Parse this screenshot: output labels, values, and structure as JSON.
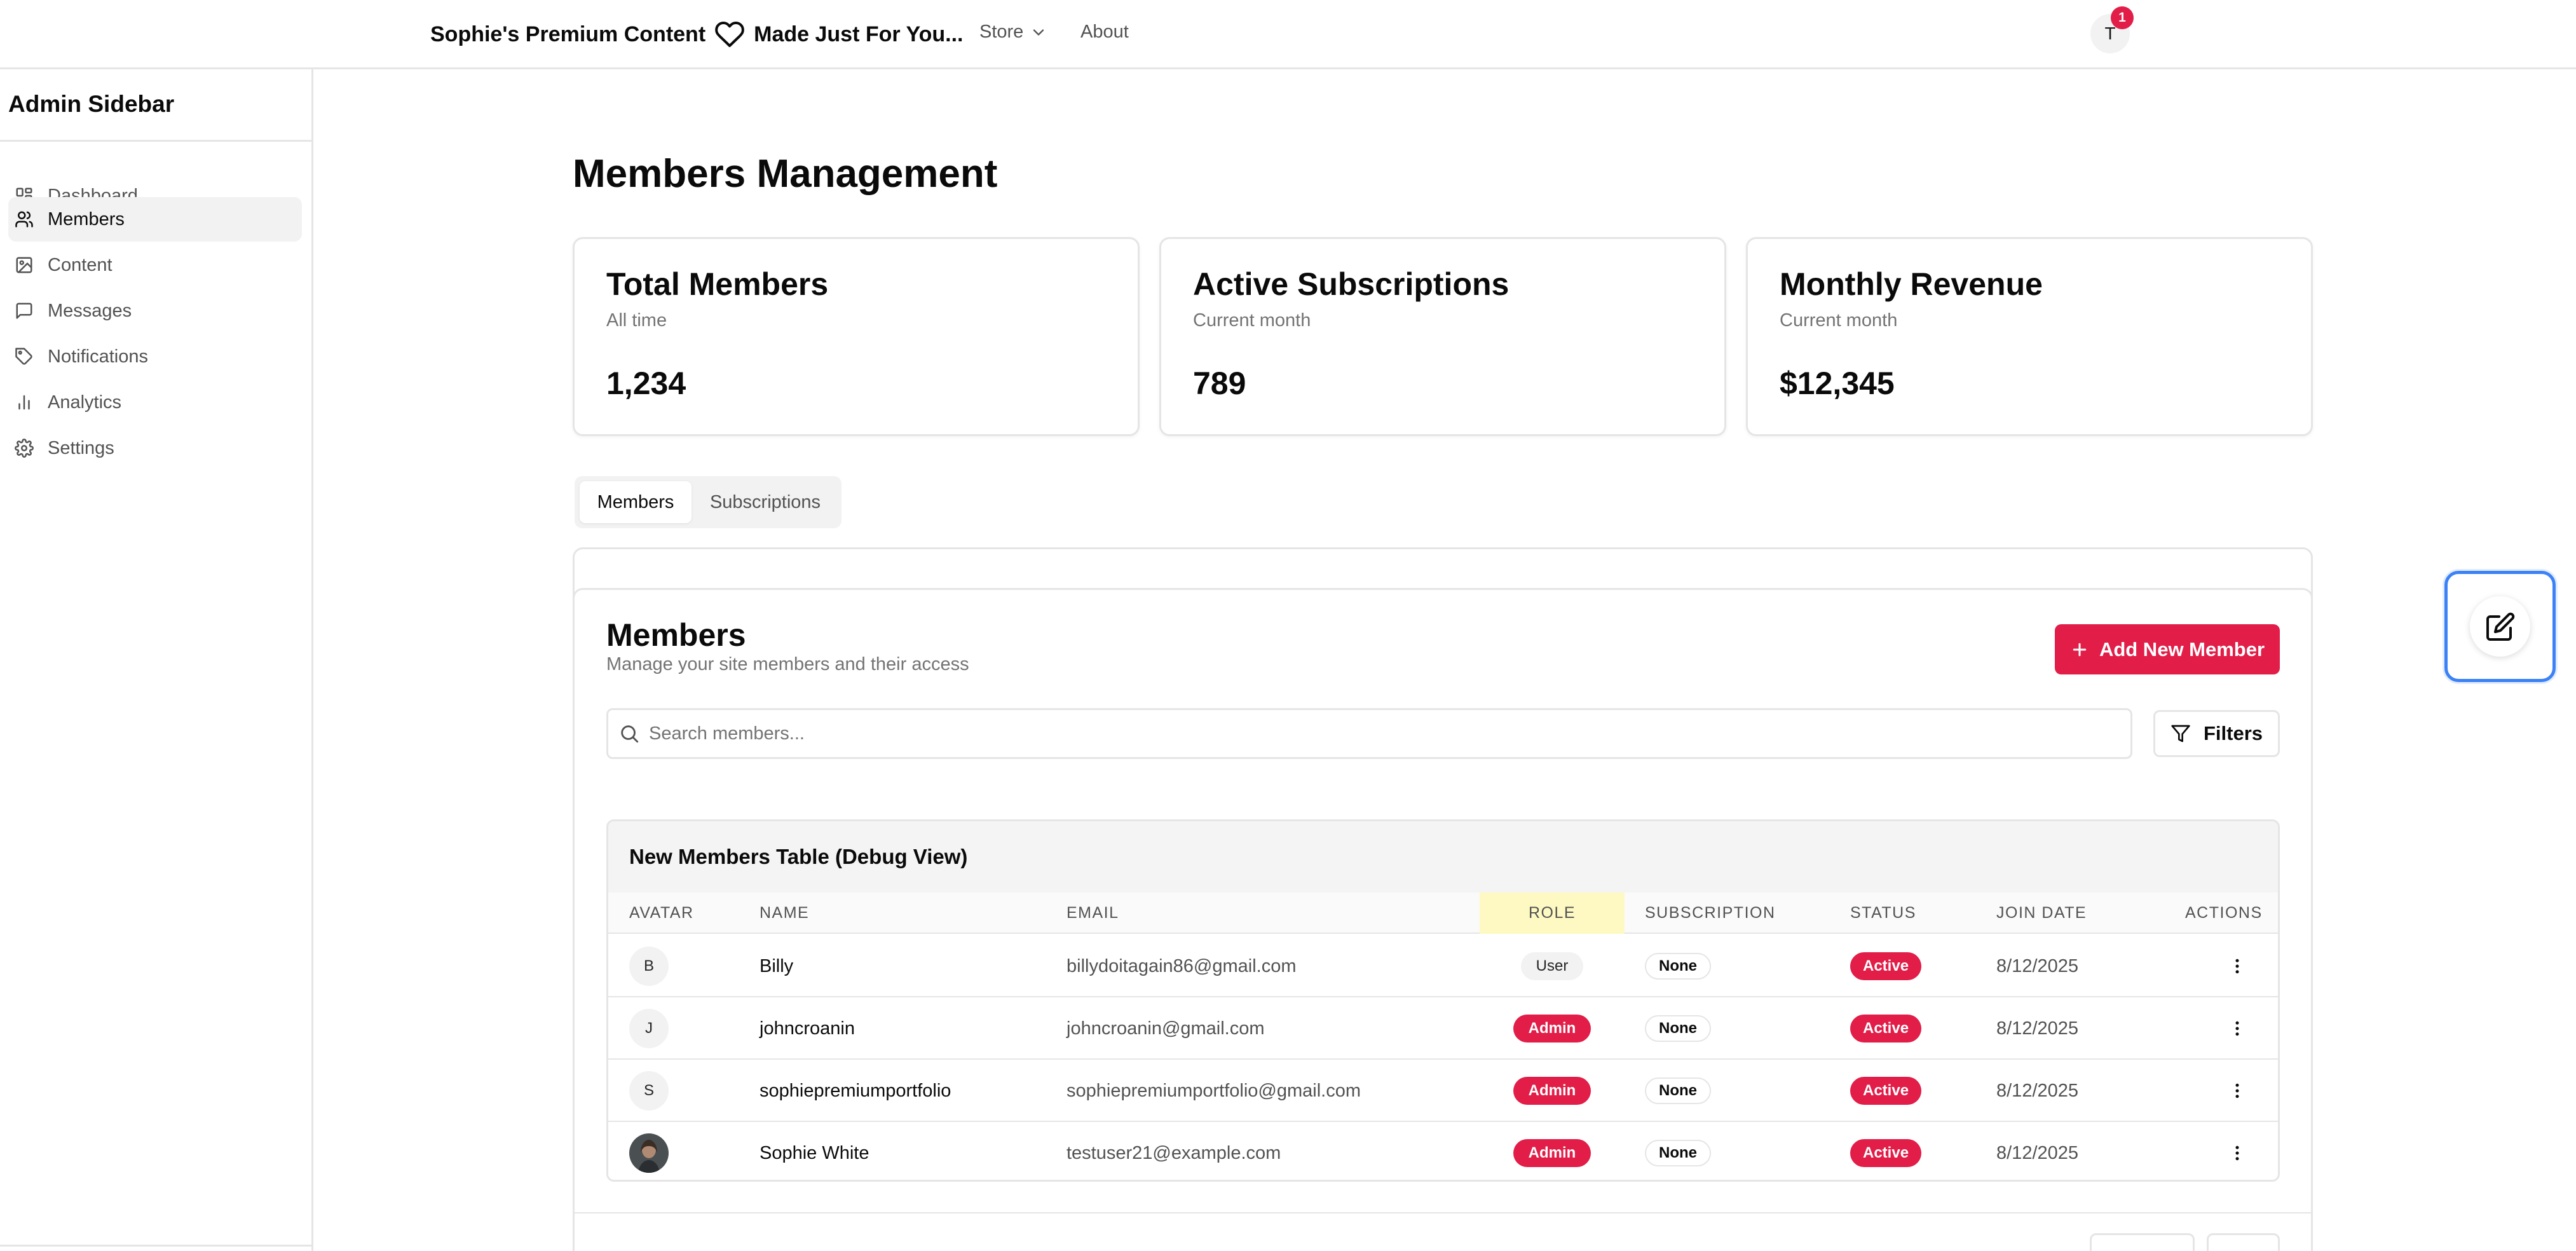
{
  "nav": {
    "brand_left": "Sophie's Premium Content",
    "brand_right": "Made Just For You...",
    "store": "Store",
    "about": "About",
    "avatar_initial": "T",
    "notification_count": "1"
  },
  "sidebar": {
    "title": "Admin Sidebar",
    "items": [
      {
        "label": "Dashboard",
        "icon": "grid-icon"
      },
      {
        "label": "Members",
        "icon": "users-icon"
      },
      {
        "label": "Content",
        "icon": "image-icon"
      },
      {
        "label": "Messages",
        "icon": "message-icon"
      },
      {
        "label": "Notifications",
        "icon": "tag-icon"
      },
      {
        "label": "Analytics",
        "icon": "bar-chart-icon"
      },
      {
        "label": "Settings",
        "icon": "gear-icon"
      }
    ],
    "active": "Members"
  },
  "main": {
    "title": "Members Management",
    "stats": [
      {
        "title": "Total Members",
        "sub": "All time",
        "value": "1,234"
      },
      {
        "title": "Active Subscriptions",
        "sub": "Current month",
        "value": "789"
      },
      {
        "title": "Monthly Revenue",
        "sub": "Current month",
        "value": "$12,345"
      }
    ],
    "tabs": [
      "Members",
      "Subscriptions"
    ],
    "members": {
      "heading": "Members",
      "subheading": "Manage your site members and their access",
      "add_button": "Add New Member",
      "search_placeholder": "Search members...",
      "filters_button": "Filters"
    },
    "table": {
      "caption": "New Members Table (Debug View)",
      "columns": [
        "AVATAR",
        "NAME",
        "EMAIL",
        "ROLE",
        "SUBSCRIPTION",
        "STATUS",
        "JOIN DATE",
        "ACTIONS"
      ],
      "rows": [
        {
          "initial": "B",
          "name": "Billy",
          "email": "billydoitagain86@gmail.com",
          "role": "User",
          "subscription": "None",
          "status": "Active",
          "join_date": "8/12/2025"
        },
        {
          "initial": "J",
          "name": "johncroanin",
          "email": "johncroanin@gmail.com",
          "role": "Admin",
          "subscription": "None",
          "status": "Active",
          "join_date": "8/12/2025"
        },
        {
          "initial": "S",
          "name": "sophiepremiumportfolio",
          "email": "sophiepremiumportfolio@gmail.com",
          "role": "Admin",
          "subscription": "None",
          "status": "Active",
          "join_date": "8/12/2025"
        },
        {
          "initial": "",
          "name": "Sophie White",
          "email": "testuser21@example.com",
          "role": "Admin",
          "subscription": "None",
          "status": "Active",
          "join_date": "8/12/2025"
        }
      ]
    }
  },
  "colors": {
    "accent": "#e11d48",
    "border": "#e5e5e5",
    "muted_text": "#737373",
    "focus_ring": "#3b82f6"
  }
}
